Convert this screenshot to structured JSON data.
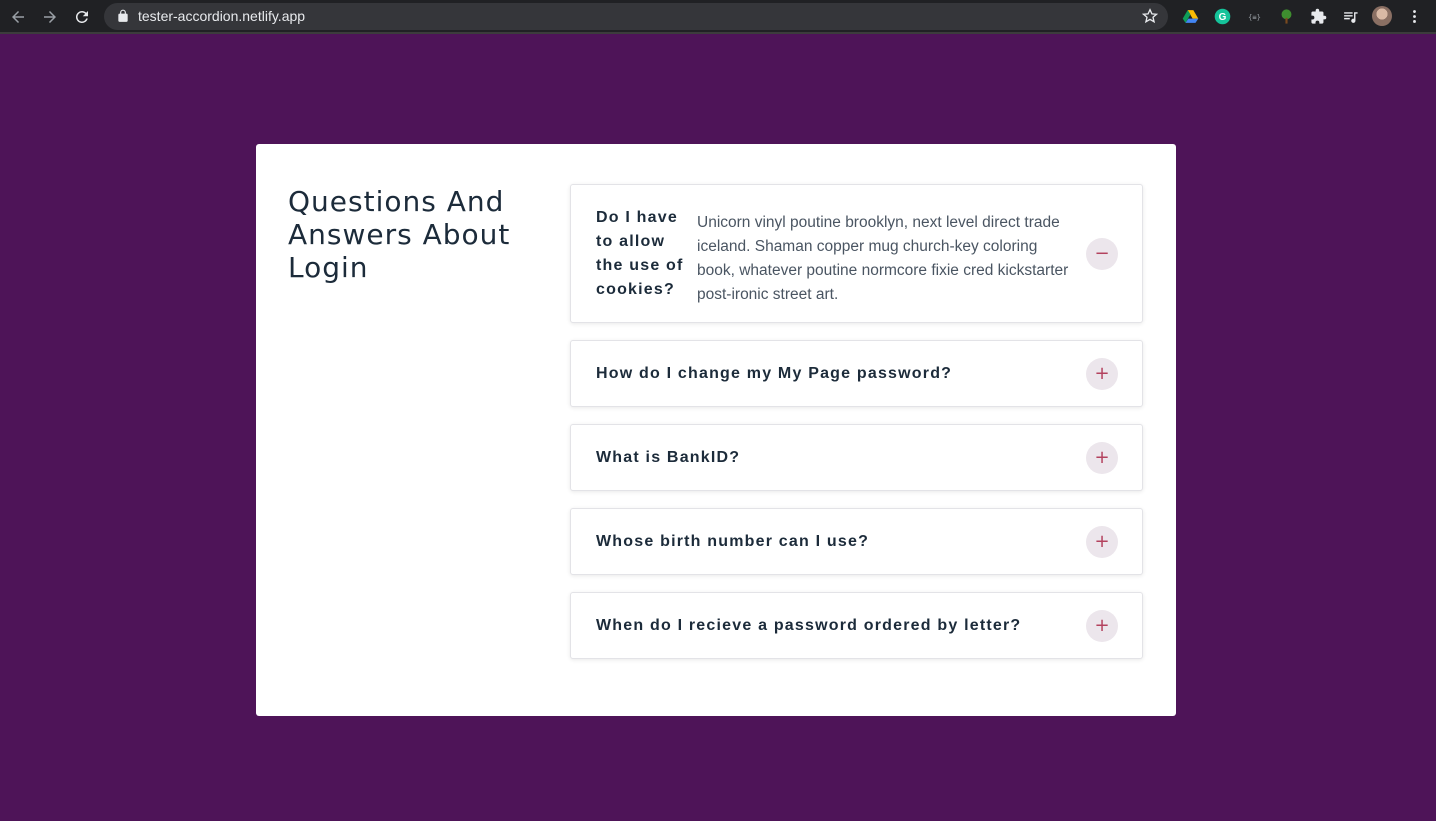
{
  "browser": {
    "url": "tester-accordion.netlify.app"
  },
  "page": {
    "title": "Questions And Answers About Login"
  },
  "faq": [
    {
      "question": "Do I have to allow the use of cookies?",
      "answer": "Unicorn vinyl poutine brooklyn, next level direct trade iceland. Shaman copper mug church-key coloring book, whatever poutine normcore fixie cred kickstarter post-ironic street art.",
      "expanded": true,
      "toggle_symbol": "−"
    },
    {
      "question": "How do I change my My Page password?",
      "expanded": false,
      "toggle_symbol": "+"
    },
    {
      "question": "What is BankID?",
      "expanded": false,
      "toggle_symbol": "+"
    },
    {
      "question": "Whose birth number can I use?",
      "expanded": false,
      "toggle_symbol": "+"
    },
    {
      "question": "When do I recieve a password ordered by letter?",
      "expanded": false,
      "toggle_symbol": "+"
    }
  ],
  "colors": {
    "background": "#4e1458",
    "card": "#ffffff",
    "title": "#1c2b3a",
    "toggle_bg": "#ece6ec",
    "toggle_icon": "#b3425e"
  }
}
